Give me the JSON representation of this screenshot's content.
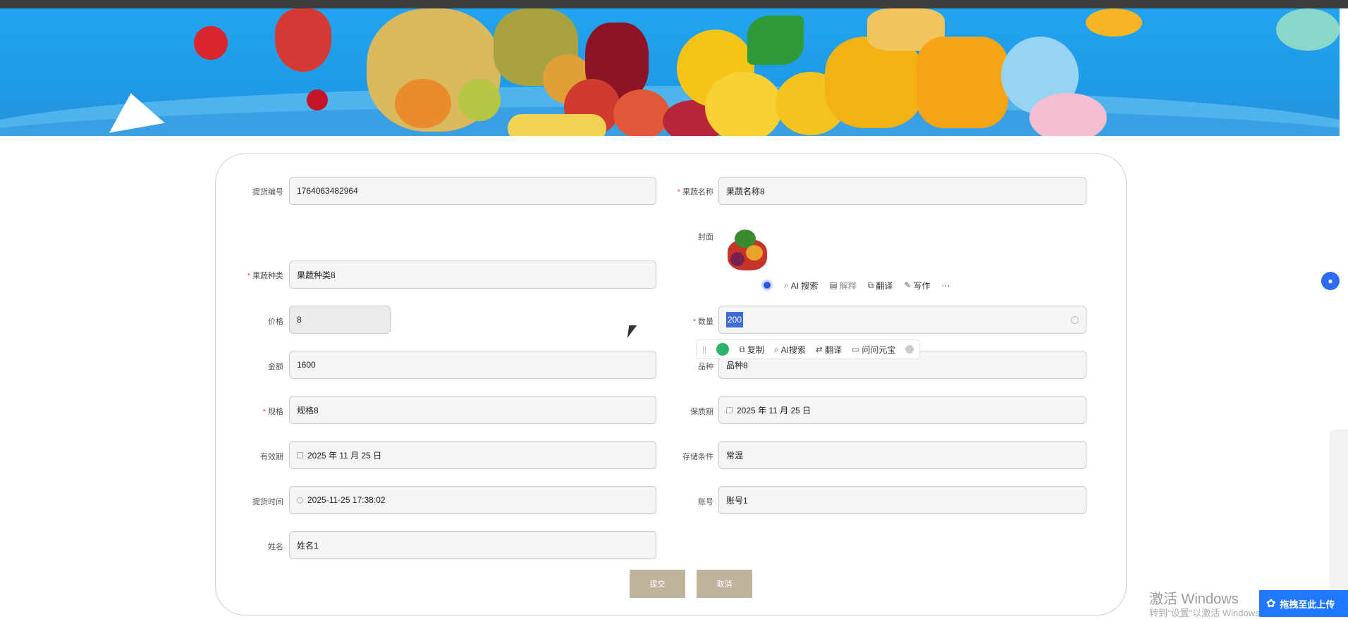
{
  "form": {
    "order_no_label": "提货编号",
    "order_no_value": "1764063482964",
    "fruit_name_label": "果蔬名称",
    "fruit_name_value": "果蔬名称8",
    "cover_label": "封面",
    "fruit_type_label": "果蔬种类",
    "fruit_type_value": "果蔬种类8",
    "price_label": "价格",
    "price_value": "8",
    "quantity_label": "数量",
    "quantity_value": "200",
    "amount_label": "金额",
    "amount_value": "1600",
    "variety_label": "品种",
    "variety_value": "品种8",
    "spec_label": "规格",
    "spec_value": "规格8",
    "shelf_life_label": "保质期",
    "shelf_life_value": "2025 年 11 月 25 日",
    "expiry_label": "有效期",
    "expiry_value": "2025 年 11 月 25 日",
    "storage_label": "存储条件",
    "storage_value": "常温",
    "pickup_time_label": "提货时间",
    "pickup_time_value": "2025-11-25 17:38:02",
    "account_label": "账号",
    "account_value": "账号1",
    "name_label": "姓名",
    "name_value": "姓名1",
    "submit_label": "提交",
    "cancel_label": "取消",
    "required_mark": "*"
  },
  "ai_toolbar": {
    "search": "AI 搜索",
    "explain": "解释",
    "translate": "翻译",
    "write": "写作",
    "more": "···"
  },
  "selection_toolbar": {
    "copy": "复制",
    "ai_search": "AI搜索",
    "translate": "翻译",
    "ask": "问问元宝"
  },
  "system": {
    "watermark_line1": "激活 Windows",
    "watermark_line2": "转到\"设置\"以激活 Windows。",
    "upload_label": "拖拽至此上传"
  },
  "colors": {
    "button": "#bfb39c",
    "banner": "#22a3f0",
    "required": "#e24d4d",
    "selection": "#3f6bd8"
  }
}
